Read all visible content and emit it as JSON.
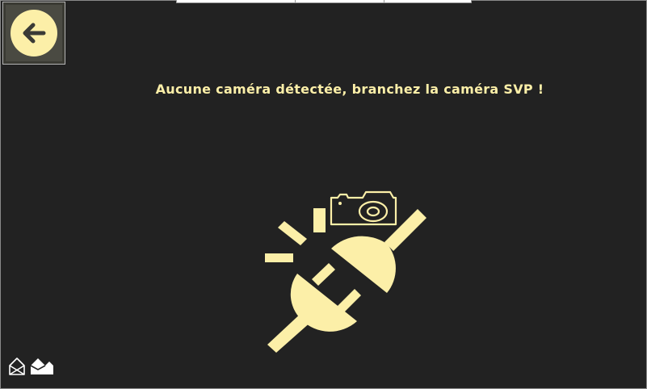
{
  "message": "Aucune caméra détectée, branchez la caméra SVP !",
  "icons": {
    "back": "arrow-left-icon",
    "illustration": "unplugged-camera-icon",
    "logo": "brand-logo-icon"
  },
  "colors": {
    "background": "#222222",
    "accent": "#fcefa8",
    "button_bg": "#4a4a42"
  }
}
